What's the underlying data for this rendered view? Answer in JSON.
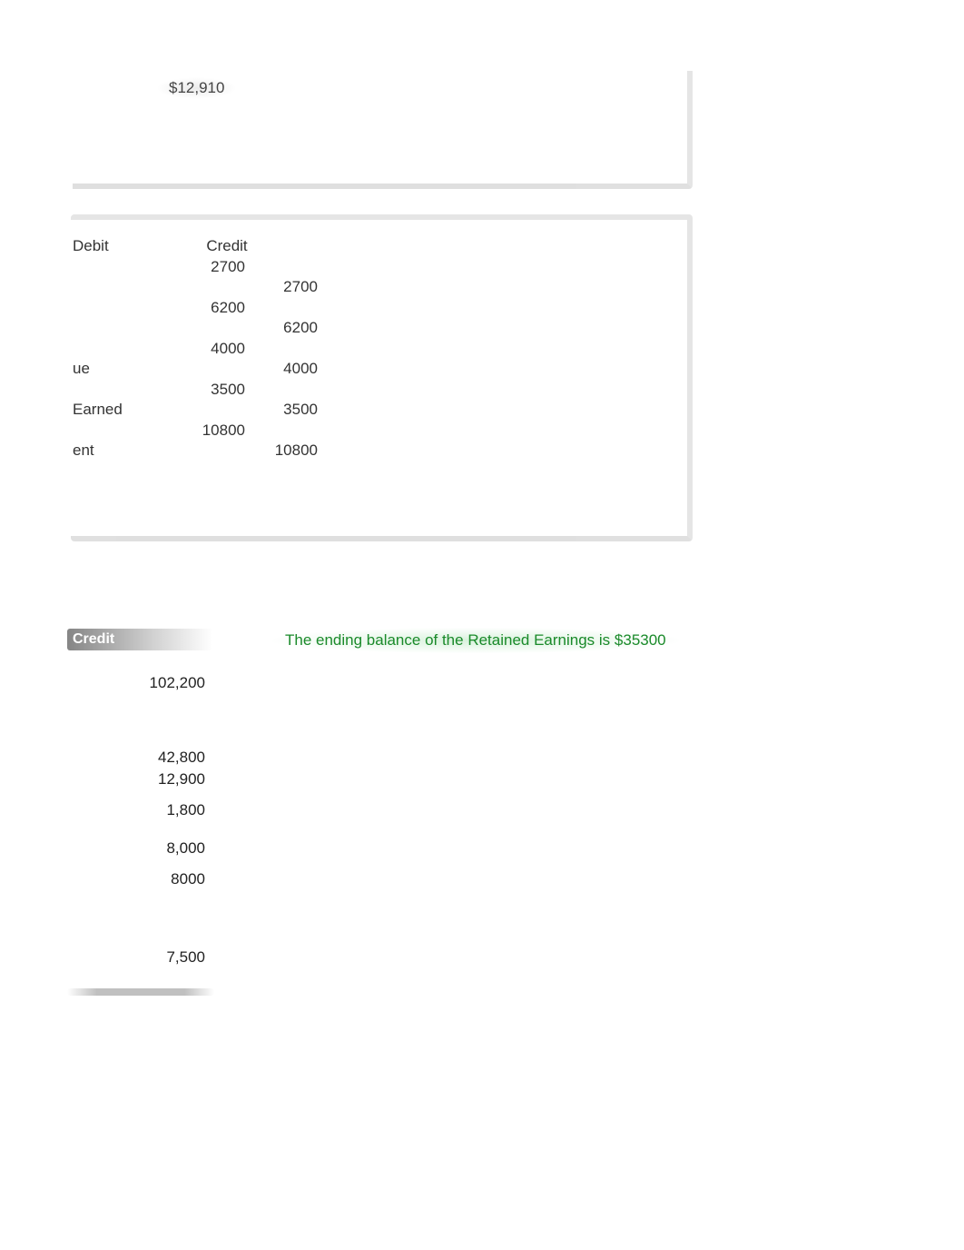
{
  "top_value": "$12,910",
  "journal": {
    "headers": {
      "label_left": "Debit",
      "debit": "",
      "credit": "Credit"
    },
    "rows": [
      {
        "label": "",
        "debit": "2700",
        "credit": ""
      },
      {
        "label": "",
        "debit": "",
        "credit": "2700"
      },
      {
        "label": "",
        "debit": "6200",
        "credit": ""
      },
      {
        "label": "",
        "debit": "",
        "credit": "6200"
      },
      {
        "label": "",
        "debit": "4000",
        "credit": ""
      },
      {
        "label": "ue",
        "debit": "",
        "credit": "4000"
      },
      {
        "label": "",
        "debit": "3500",
        "credit": ""
      },
      {
        "label": "Earned",
        "debit": "",
        "credit": "3500"
      },
      {
        "label": "",
        "debit": "10800",
        "credit": ""
      },
      {
        "label": "ent",
        "debit": "",
        "credit": "10800"
      }
    ]
  },
  "credit_section": {
    "header": "Credit",
    "note": "The ending balance of the Retained Earnings is $35300",
    "values": [
      {
        "text": "102,200",
        "gap_after": 58
      },
      {
        "text": "42,800",
        "gap_after": 0
      },
      {
        "text": "12,900",
        "gap_after": 10
      },
      {
        "text": "1,800",
        "gap_after": 18
      },
      {
        "text": "8,000",
        "gap_after": 10
      },
      {
        "text": "8000",
        "gap_after": 62
      },
      {
        "text": "7,500",
        "gap_after": 0
      }
    ]
  }
}
